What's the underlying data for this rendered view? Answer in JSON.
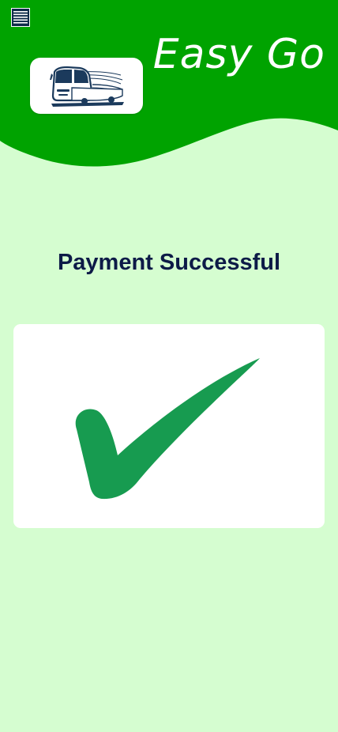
{
  "app": {
    "title": "Easy Go"
  },
  "header": {
    "menu_icon": "hamburger-menu-icon",
    "logo_icon": "bus-icon"
  },
  "main": {
    "heading": "Payment Successful",
    "status_icon": "check-mark-icon"
  },
  "colors": {
    "header_green": "#00a300",
    "page_background": "#d5fdd0",
    "heading_text": "#0d1a47",
    "check_green": "#179b50",
    "menu_button": "#0d2b4a"
  }
}
